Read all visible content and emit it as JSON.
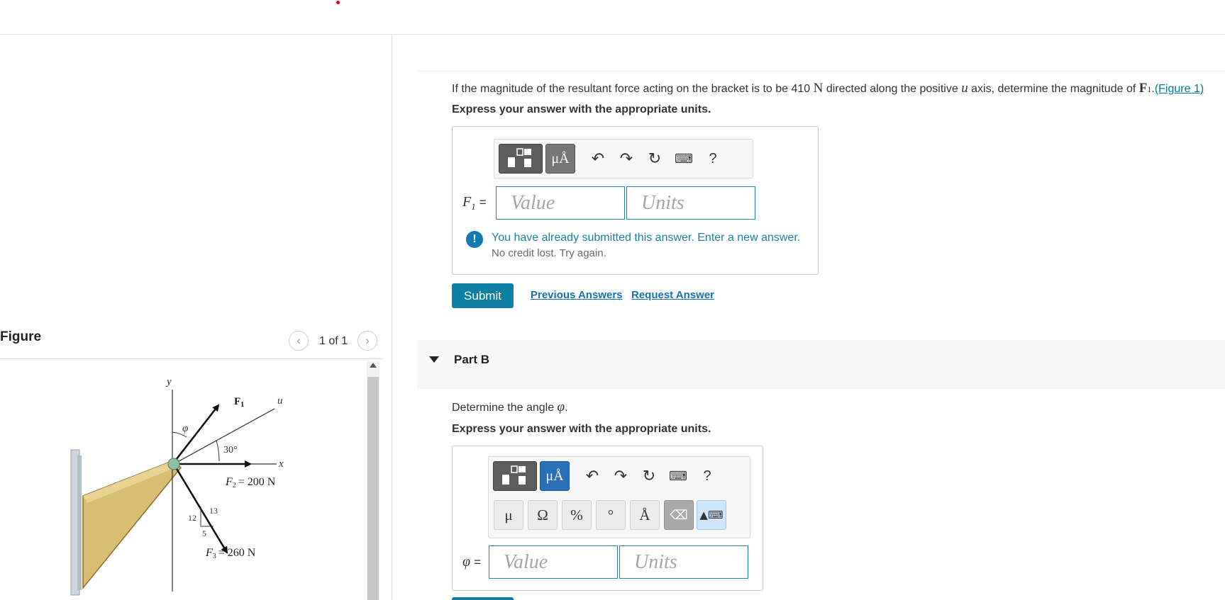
{
  "figure": {
    "title": "Figure",
    "counter": "1 of 1",
    "labels": {
      "y": "y",
      "u": "u",
      "x": "x",
      "phi": "φ",
      "f1": "F",
      "f1_sub": "1",
      "angle": "30°",
      "f2": "F",
      "f2_sub": "2",
      "f2_value": "= 200 N",
      "f3": "F",
      "f3_sub": "3",
      "f3_value": "= 260 N",
      "tri_12": "12",
      "tri_13": "13",
      "tri_5": "5"
    }
  },
  "partA": {
    "question_pre": "If the magnitude of the resultant force acting on the bracket is to be 410",
    "question_unit": "N",
    "question_mid": "directed along the positive",
    "question_axis": "u",
    "question_post": "axis, determine the magnitude of",
    "question_var": "F",
    "question_var_sub": "1",
    "question_link": "(Figure 1)",
    "instruction": "Express your answer with the appropriate units.",
    "toolbar": {
      "mu_label": "μÅ",
      "help": "?"
    },
    "eq_var": "F",
    "eq_sub": "1",
    "eq_sign": "=",
    "value_placeholder": "Value",
    "units_placeholder": "Units",
    "warning_icon": "!",
    "warning": "You have already submitted this answer. Enter a new answer.",
    "warning_sub": "No credit lost. Try again.",
    "submit": "Submit",
    "previous_answers": "Previous Answers",
    "request_answer": "Request Answer"
  },
  "partB": {
    "title": "Part B",
    "question_pre": "Determine the angle",
    "question_var": "φ",
    "question_post": ".",
    "instruction": "Express your answer with the appropriate units.",
    "toolbar": {
      "mu_label": "μÅ",
      "help": "?"
    },
    "symbols": [
      "μ",
      "Ω",
      "%",
      "°",
      "Å"
    ],
    "eq_var": "φ",
    "eq_sign": "=",
    "value_placeholder": "Value",
    "units_placeholder": "Units"
  },
  "colors": {
    "accent": "#0d7fa2",
    "link": "#1273b3",
    "warning": "#0f7bb1",
    "mu_active": "#2b6fb6"
  }
}
